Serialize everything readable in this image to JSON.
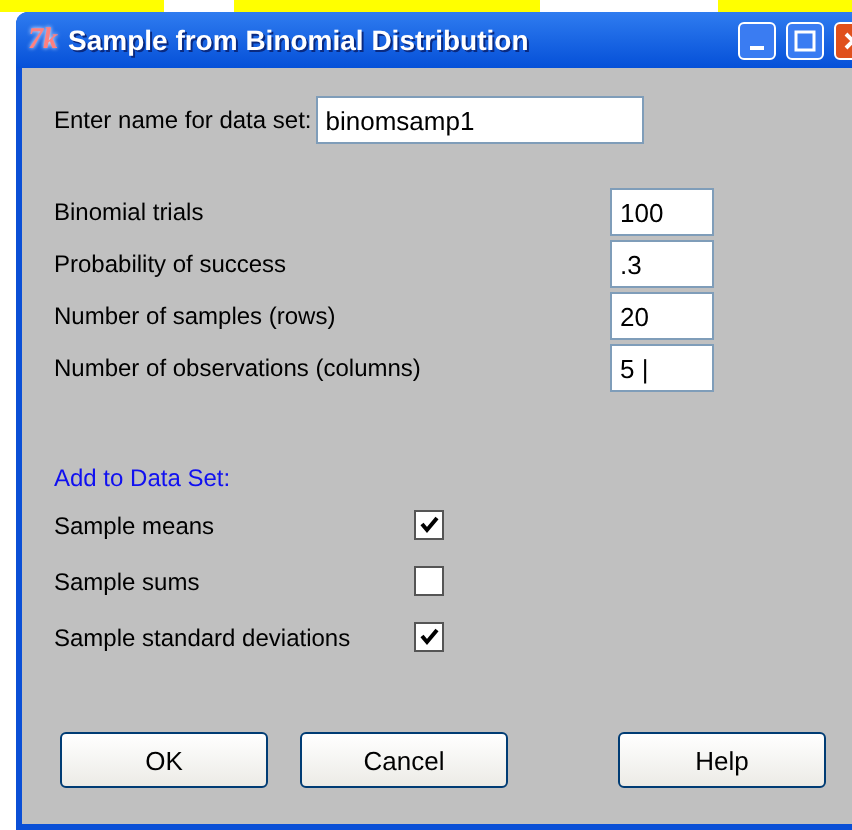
{
  "window": {
    "title": "Sample from Binomial Distribution",
    "app_icon": "7k"
  },
  "name_field": {
    "label": "Enter name for data set:",
    "value": "binomsamp1"
  },
  "parameters": [
    {
      "label": "Binomial trials",
      "value": "100"
    },
    {
      "label": "Probability of success",
      "value": ".3"
    },
    {
      "label": "Number of samples (rows)",
      "value": "20"
    },
    {
      "label": "Number of observations (columns)",
      "value": "5 |"
    }
  ],
  "add_to_data_set": {
    "heading": "Add to Data Set:",
    "options": [
      {
        "label": "Sample means",
        "checked": true
      },
      {
        "label": "Sample sums",
        "checked": false
      },
      {
        "label": "Sample standard deviations",
        "checked": true
      }
    ]
  },
  "buttons": [
    "OK",
    "Cancel",
    "Help"
  ]
}
